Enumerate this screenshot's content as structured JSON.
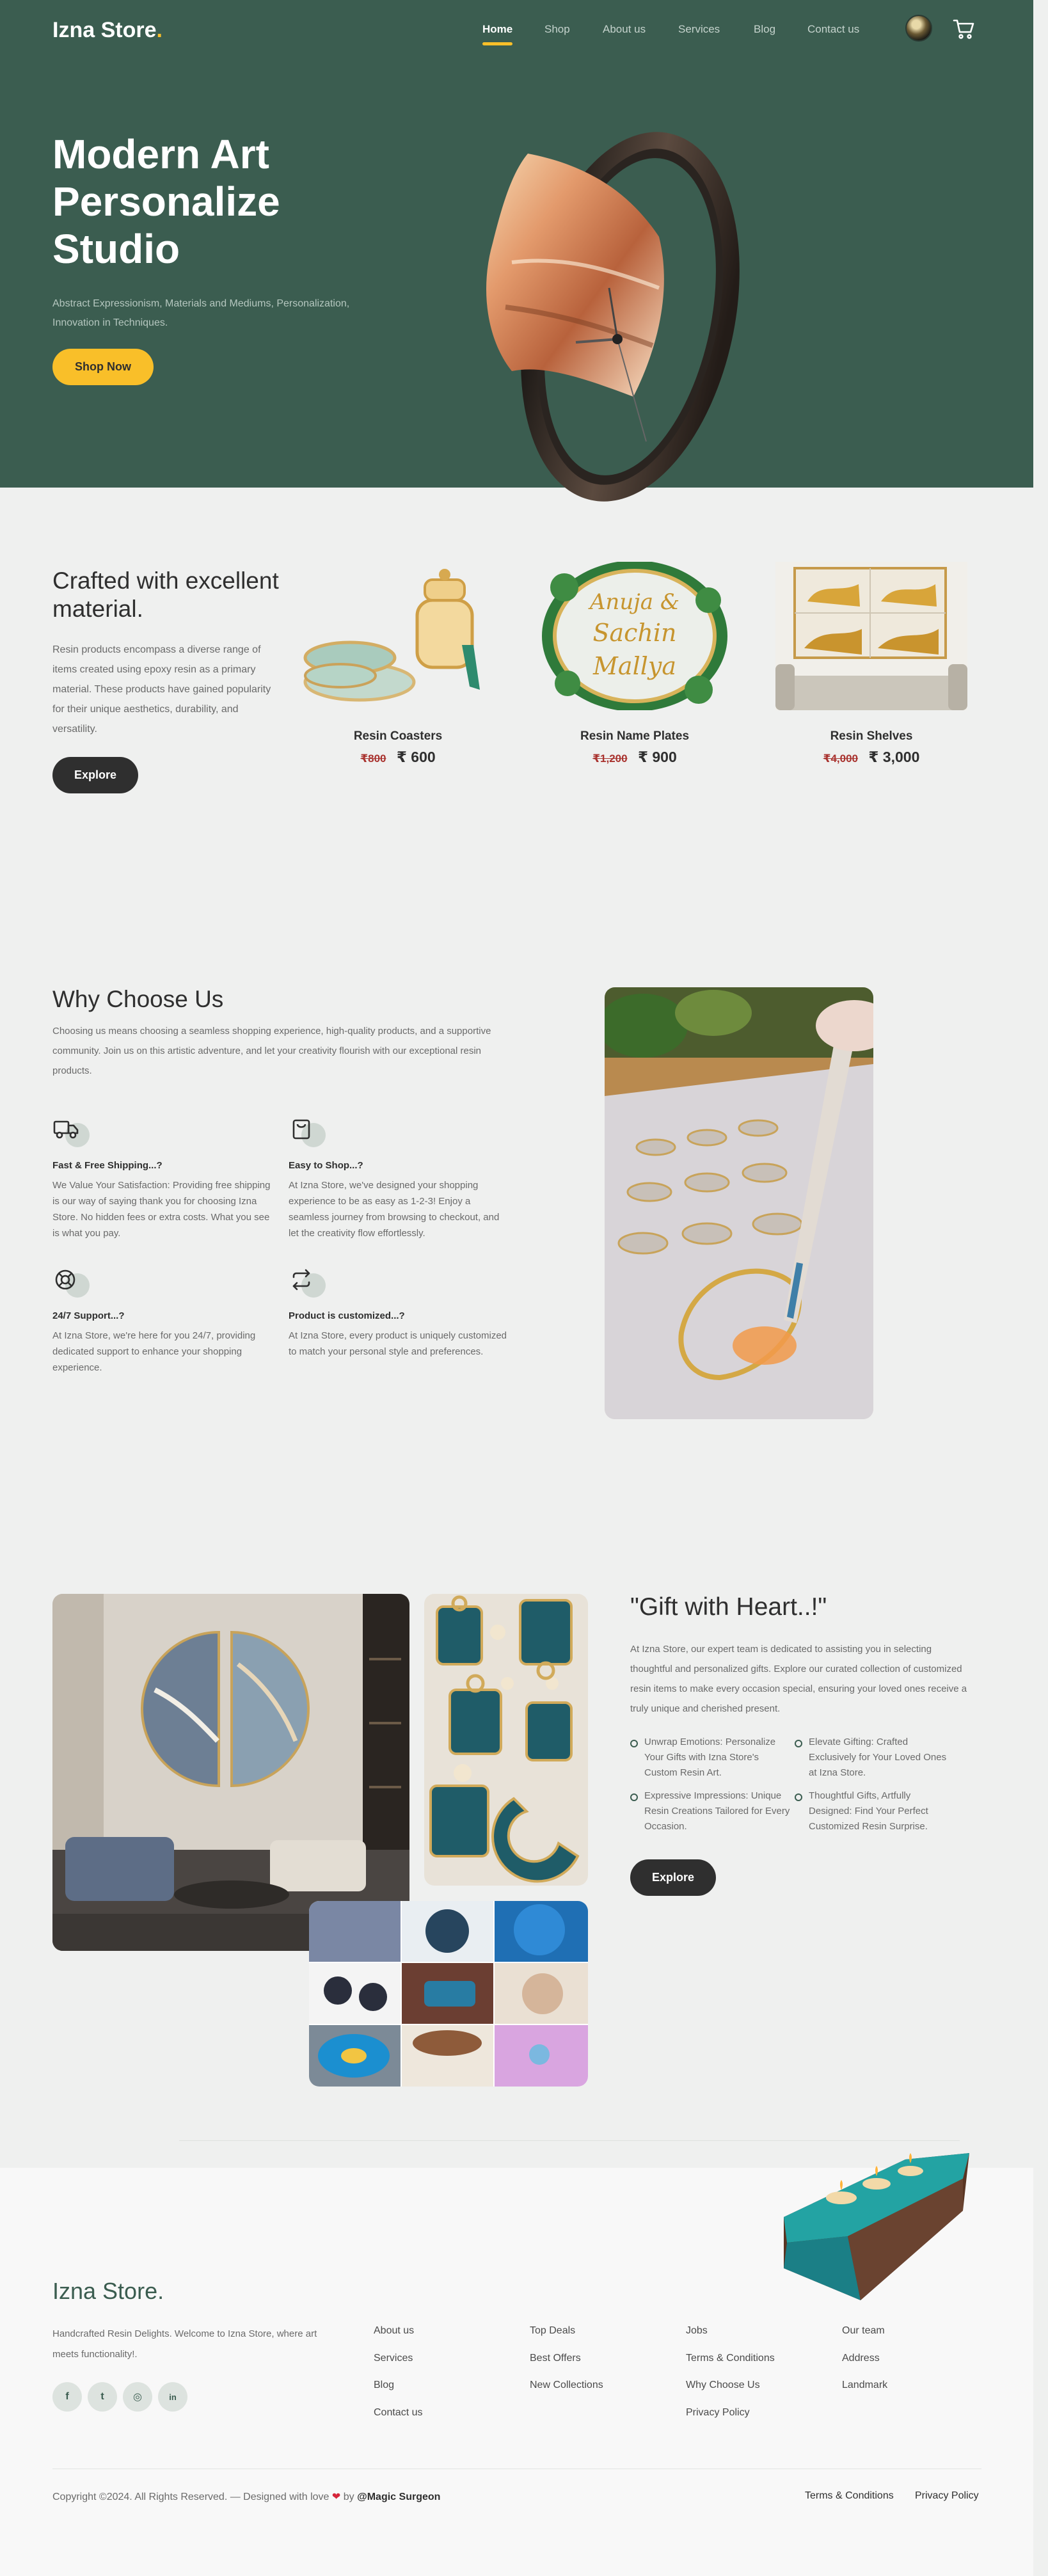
{
  "brand": {
    "name": "Izna Store",
    "dot": "."
  },
  "nav": {
    "items": [
      {
        "label": "Home",
        "active": true
      },
      {
        "label": "Shop"
      },
      {
        "label": "About us"
      },
      {
        "label": "Services"
      },
      {
        "label": "Blog"
      },
      {
        "label": "Contact us"
      }
    ],
    "accent": "#f9bf29"
  },
  "hero": {
    "title": "Modern Art Personalize Studio",
    "subtitle": "Abstract Expressionism, Materials and Mediums, Personalization, Innovation in Techniques.",
    "cta": "Shop Now",
    "bg_color": "#3b5d50"
  },
  "crafted": {
    "title": "Crafted with excellent material.",
    "text": "Resin products encompass a diverse range of items created using epoxy resin as a primary material. These products have gained popularity for their unique aesthetics, durability, and versatility.",
    "cta": "Explore",
    "products": [
      {
        "name": "Resin Coasters",
        "old_price": "₹800",
        "price": "₹ 600"
      },
      {
        "name": "Resin Name Plates",
        "old_price": "₹1,200",
        "price": "₹ 900",
        "plate_text": [
          "Anuja &",
          "Sachin",
          "Mallya"
        ]
      },
      {
        "name": "Resin Shelves",
        "old_price": "₹4,000",
        "price": "₹ 3,000"
      }
    ]
  },
  "why": {
    "title": "Why Choose Us",
    "text": "Choosing us means choosing a seamless shopping experience, high-quality products, and a supportive community. Join us on this artistic adventure, and let your creativity flourish with our exceptional resin products.",
    "features": [
      {
        "icon": "truck-icon",
        "title": "Fast & Free Shipping...?",
        "text": "We Value Your Satisfaction: Providing free shipping is our way of saying thank you for choosing Izna Store. No hidden fees or extra costs. What you see is what you pay."
      },
      {
        "icon": "bag-icon",
        "title": "Easy to Shop...?",
        "text": "At Izna Store, we've designed your shopping experience to be as easy as 1-2-3! Enjoy a seamless journey from browsing to checkout, and let the creativity flow effortlessly."
      },
      {
        "icon": "support-icon",
        "title": "24/7 Support...?",
        "text": "At Izna Store, we're here for you 24/7, providing dedicated support to enhance your shopping experience."
      },
      {
        "icon": "repeat-icon",
        "title": "Product is customized...?",
        "text": "At Izna Store, every product is uniquely customized to match your personal style and preferences."
      }
    ]
  },
  "gift": {
    "title": "\"Gift with Heart..!\"",
    "text": "At Izna Store, our expert team is dedicated to assisting you in selecting thoughtful and personalized gifts. Explore our curated collection of customized resin items to make every occasion special, ensuring your loved ones receive a truly unique and cherished present.",
    "bullets": [
      "Unwrap Emotions: Personalize Your Gifts with Izna Store's Custom Resin Art.",
      "Elevate Gifting: Crafted Exclusively for Your Loved Ones at Izna Store.",
      "Expressive Impressions: Unique Resin Creations Tailored for Every Occasion.",
      "Thoughtful Gifts, Artfully Designed: Find Your Perfect Customized Resin Surprise."
    ],
    "cta": "Explore"
  },
  "footer": {
    "brand": "Izna Store.",
    "text": "Handcrafted Resin Delights. Welcome to Izna Store, where art meets functionality!.",
    "social": [
      {
        "icon": "facebook-icon",
        "glyph": "f"
      },
      {
        "icon": "twitter-icon",
        "glyph": "t"
      },
      {
        "icon": "instagram-icon",
        "glyph": "◎"
      },
      {
        "icon": "linkedin-icon",
        "glyph": "in"
      }
    ],
    "columns": [
      [
        "About us",
        "Services",
        "Blog",
        "Contact us"
      ],
      [
        "Top Deals",
        "Best Offers",
        "New Collections"
      ],
      [
        "Jobs",
        "Terms & Conditions",
        "Why Choose Us",
        "Privacy Policy"
      ],
      [
        "Our team",
        "Address",
        "Landmark"
      ]
    ],
    "copyright_pre": "Copyright ©2024. All Rights Reserved. — Designed with love",
    "heart": "❤",
    "by": "by",
    "author": "@Magic Surgeon",
    "legal": [
      "Terms & Conditions",
      "Privacy Policy"
    ]
  }
}
